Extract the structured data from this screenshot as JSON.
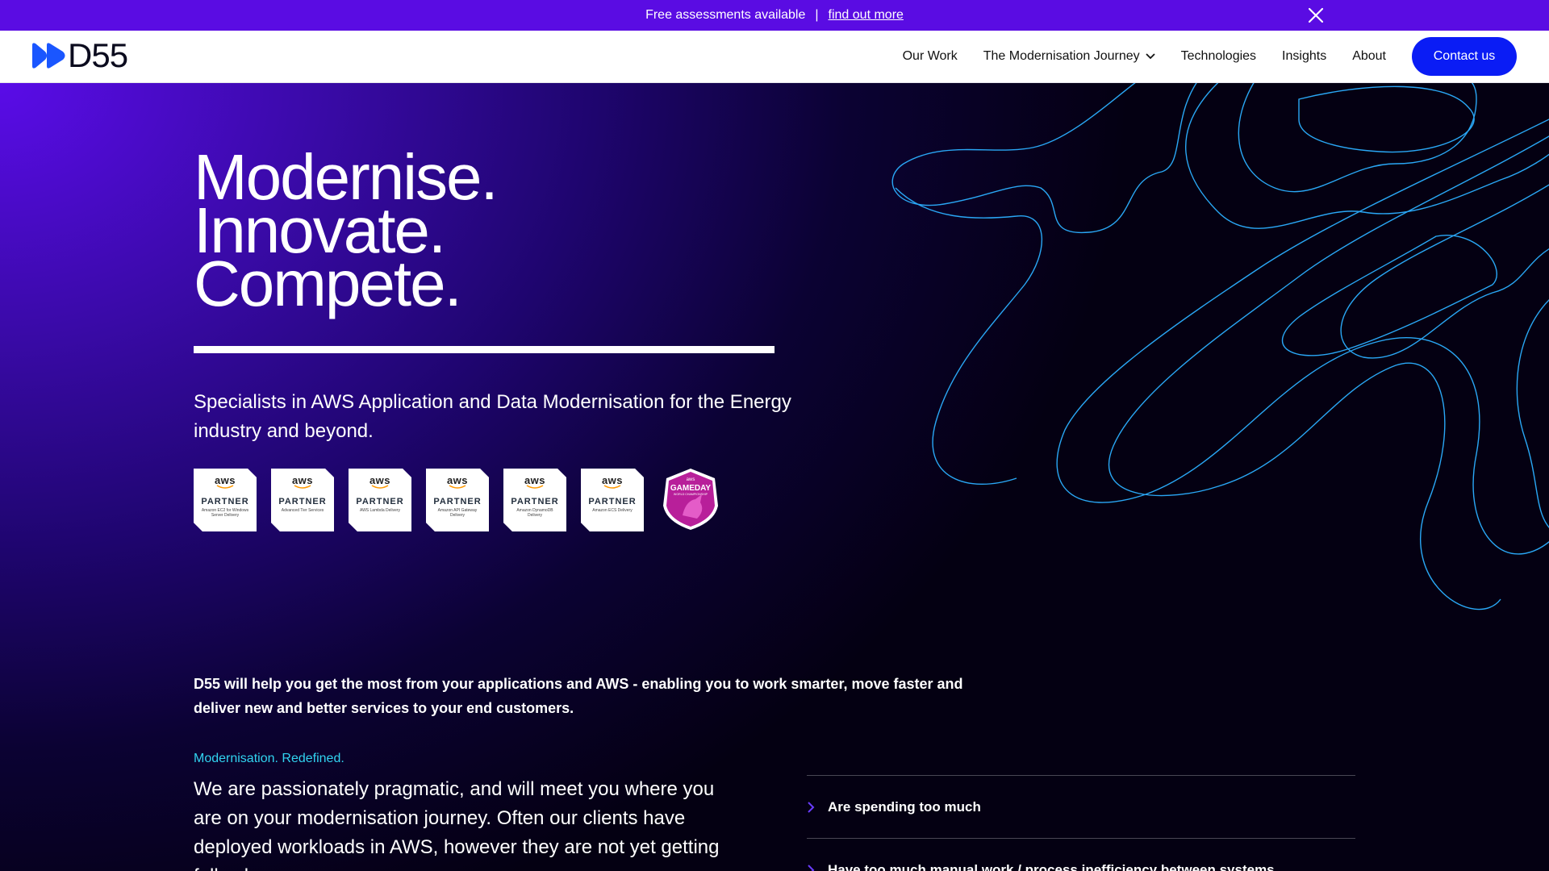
{
  "announcement": {
    "text": "Free assessments available",
    "separator": "|",
    "link_label": "find out more"
  },
  "nav": {
    "brand": "D55",
    "items": [
      {
        "label": "Our Work"
      },
      {
        "label": "The Modernisation Journey",
        "dropdown": true
      },
      {
        "label": "Technologies"
      },
      {
        "label": "Insights"
      },
      {
        "label": "About"
      }
    ],
    "cta": "Contact us"
  },
  "hero": {
    "headline": [
      "Modernise.",
      "Innovate.",
      "Compete."
    ],
    "lede": "Specialists in AWS Application and Data Modernisation for the Energy industry and beyond.",
    "badges": [
      {
        "brand": "aws",
        "title": "PARTNER",
        "sub": "Amazon EC2 for Windows Server Delivery"
      },
      {
        "brand": "aws",
        "title": "PARTNER",
        "sub": "Advanced Tier Services"
      },
      {
        "brand": "aws",
        "title": "PARTNER",
        "sub": "AWS Lambda Delivery"
      },
      {
        "brand": "aws",
        "title": "PARTNER",
        "sub": "Amazon API Gateway Delivery"
      },
      {
        "brand": "aws",
        "title": "PARTNER",
        "sub": "Amazon DynamoDB Delivery"
      },
      {
        "brand": "aws",
        "title": "PARTNER",
        "sub": "Amazon ECS Delivery"
      }
    ],
    "gameday": {
      "brand": "aws",
      "title": "GAMEDAY",
      "sub": "WORLD CHAMPIONSHIP"
    }
  },
  "intro": {
    "pitch": "D55 will help you get the most from your applications and AWS - enabling you to work smarter, move faster and deliver new and better services to your end customers.",
    "eyebrow": "Modernisation. Redefined.",
    "body": "We are passionately pragmatic, and will meet you where you are on your modernisation journey. Often our clients have deployed workloads in AWS, however they are not yet getting full value"
  },
  "accordion": [
    {
      "label": "Are spending too much"
    },
    {
      "label": "Have too much manual work / process inefficiency between systems"
    }
  ],
  "colors": {
    "announce_bg": "#5a0ce3",
    "cta_bg": "#0a1cf5",
    "eyebrow": "#31d4f0",
    "contour": "#2aa7f5"
  }
}
